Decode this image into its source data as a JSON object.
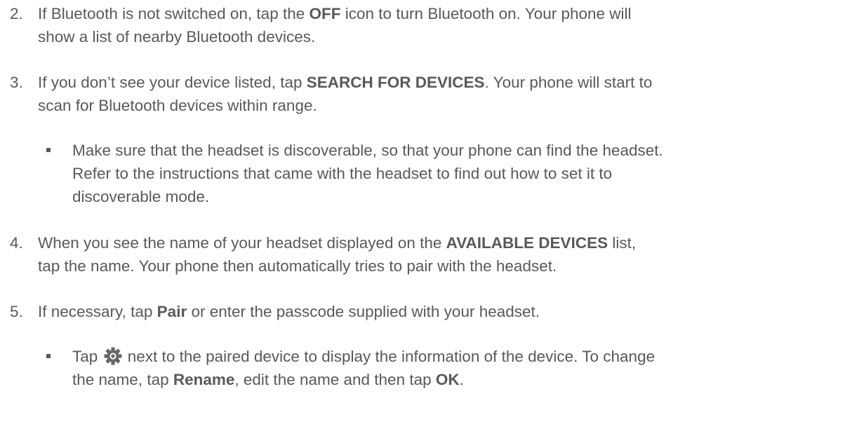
{
  "steps": [
    {
      "number": "2.",
      "parts": [
        {
          "t": "If Bluetooth is not switched on, tap the "
        },
        {
          "t": "OFF",
          "b": true
        },
        {
          "t": " icon to turn Bluetooth on. Your phone will"
        }
      ],
      "line2": "show a list of nearby Bluetooth devices."
    },
    {
      "number": "3.",
      "parts": [
        {
          "t": "If you don’t see your device listed, tap "
        },
        {
          "t": "SEARCH FOR DEVICES",
          "b": true
        },
        {
          "t": ". Your phone will start to"
        }
      ],
      "line2": "scan for Bluetooth devices within range."
    },
    {
      "number": "4.",
      "parts": [
        {
          "t": "When you see the name of your headset displayed on the "
        },
        {
          "t": "AVAILABLE DEVICES",
          "b": true
        },
        {
          "t": " list,"
        }
      ],
      "line2": "tap the name. Your phone then automatically tries to pair with the headset."
    },
    {
      "number": "5.",
      "parts": [
        {
          "t": "If necessary, tap "
        },
        {
          "t": "Pair",
          "b": true
        },
        {
          "t": " or enter the passcode supplied with your headset."
        }
      ]
    }
  ],
  "bullet1": {
    "lines": [
      "Make sure that the headset is discoverable, so that your phone can find the headset.",
      "Refer to the instructions that came with the headset to find out how to set it to",
      "discoverable mode."
    ]
  },
  "bullet2": {
    "pre": "Tap ",
    "icon": "gear-icon",
    "post": " next to the paired device to display the information of the device. To change",
    "line2_pre": "the name, tap ",
    "rename": "Rename",
    "line2_mid": ", edit the name and then tap ",
    "ok": "OK",
    "line2_end": "."
  }
}
